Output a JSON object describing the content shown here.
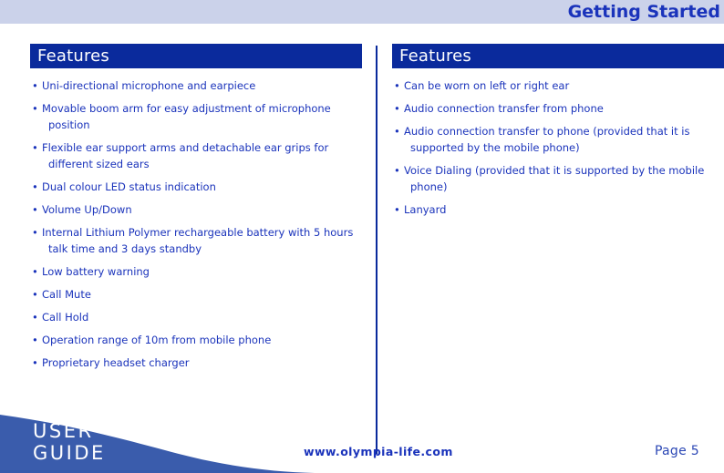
{
  "header": {
    "title": "Getting Started",
    "band_color": "#cbd2ea",
    "title_color": "#1a33bb"
  },
  "colors": {
    "dark_blue": "#0a2a9c",
    "text_blue": "#1a33bb",
    "wave_blue": "#3a5cac",
    "header_band": "#cbd2ea"
  },
  "left_column": {
    "section_title": "Features",
    "bullet": "•",
    "items": [
      "Uni-directional microphone and earpiece",
      "Movable boom arm for easy adjustment of microphone position",
      "Flexible ear support arms and detachable ear grips for different sized ears",
      "Dual colour LED status indication",
      "Volume Up/Down",
      "Internal Lithium Polymer rechargeable battery with 5 hours talk time and 3 days standby",
      "Low battery warning",
      "Call Mute",
      "Call Hold",
      "Operation range of 10m from mobile phone",
      "Proprietary headset charger"
    ]
  },
  "right_column": {
    "section_title": "Features",
    "bullet": "•",
    "items": [
      "Can be worn on left or right ear",
      "Audio connection transfer from phone",
      "Audio connection transfer to phone (provided that it is supported by the mobile phone)",
      "Voice Dialing (provided that it is supported by the mobile phone)",
      "Lanyard"
    ]
  },
  "footer": {
    "user_guide_line1": "USER",
    "user_guide_line2": "GUIDE",
    "url": "www.olympia-life.com",
    "page_label": "Page 5"
  }
}
